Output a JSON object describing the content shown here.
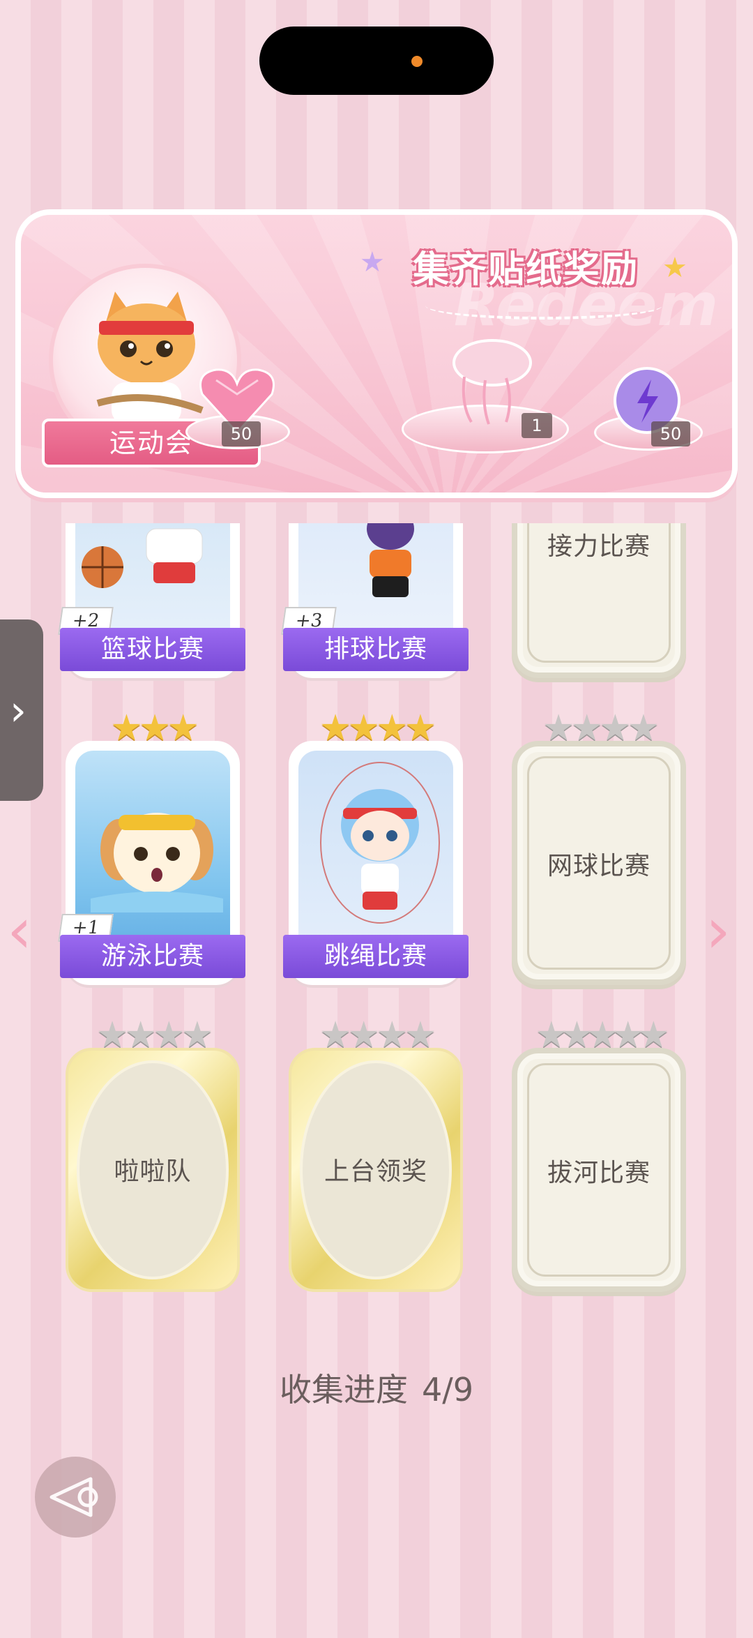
{
  "banner": {
    "title": "集齐贴纸奖励",
    "ghost_text": "Redeem",
    "event_name": "运动会",
    "rewards": [
      {
        "name": "heart-gem",
        "count": "50"
      },
      {
        "name": "jellyfish-ornament",
        "count": "1"
      },
      {
        "name": "energy-orb",
        "count": "50"
      }
    ]
  },
  "cards": [
    {
      "label": "篮球比赛",
      "collected": true,
      "bonus": "+2",
      "stars": 0
    },
    {
      "label": "排球比赛",
      "collected": true,
      "bonus": "+3",
      "stars": 0
    },
    {
      "label": "接力比赛",
      "collected": false,
      "stars": 0
    },
    {
      "label": "游泳比赛",
      "collected": true,
      "bonus": "+1",
      "stars": 3,
      "stars_filled": 3
    },
    {
      "label": "跳绳比赛",
      "collected": true,
      "stars": 4,
      "stars_filled": 4
    },
    {
      "label": "网球比赛",
      "collected": false,
      "stars": 4,
      "stars_filled": 0
    },
    {
      "label": "啦啦队",
      "collected": false,
      "golden": true,
      "stars": 4,
      "stars_filled": 0
    },
    {
      "label": "上台领奖",
      "collected": false,
      "golden": true,
      "stars": 4,
      "stars_filled": 0
    },
    {
      "label": "拔河比赛",
      "collected": false,
      "stars": 5,
      "stars_filled": 0
    }
  ],
  "progress": {
    "label": "收集进度",
    "value": "4/9"
  },
  "colors": {
    "banner_pink": "#f6b9ca",
    "name_banner_purple": "#8a5ae6",
    "star_gold": "#f3c23c",
    "star_grey": "#c9c6c5"
  }
}
